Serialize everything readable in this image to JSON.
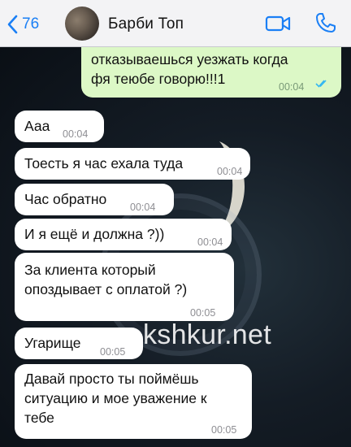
{
  "header": {
    "back_count": "76",
    "contact_name": "Барби Топ"
  },
  "watermark": "kshkur.net",
  "messages": [
    {
      "direction": "out",
      "lines": [
        "отказываешься уезжать когда",
        "фя  теюбе говорю!!!1"
      ],
      "time": "00:04",
      "status": "read"
    },
    {
      "direction": "in",
      "text": "Ааа",
      "time": "00:04"
    },
    {
      "direction": "in",
      "text": "Тоесть я час ехала туда",
      "time": "00:04"
    },
    {
      "direction": "in",
      "text": "Час обратно",
      "time": "00:04"
    },
    {
      "direction": "in",
      "text": "И я ещё и должна ?))",
      "time": "00:04"
    },
    {
      "direction": "in",
      "lines": [
        "За клиента который",
        "опоздывает с оплатой ?)"
      ],
      "time": "00:05"
    },
    {
      "direction": "in",
      "text": "Угарище",
      "time": "00:05"
    },
    {
      "direction": "in",
      "lines": [
        "Давай просто ты поймёшь",
        "ситуацию и мое уважение к",
        "тебе"
      ],
      "time": "00:05"
    }
  ],
  "colors": {
    "accent": "#1a7ff5",
    "outgoing_bubble": "#dcf8c6",
    "incoming_bubble": "#ffffff"
  },
  "icons": {
    "back": "chevron-left-icon",
    "video": "video-camera-icon",
    "call": "phone-icon",
    "read_status": "double-check-icon"
  }
}
